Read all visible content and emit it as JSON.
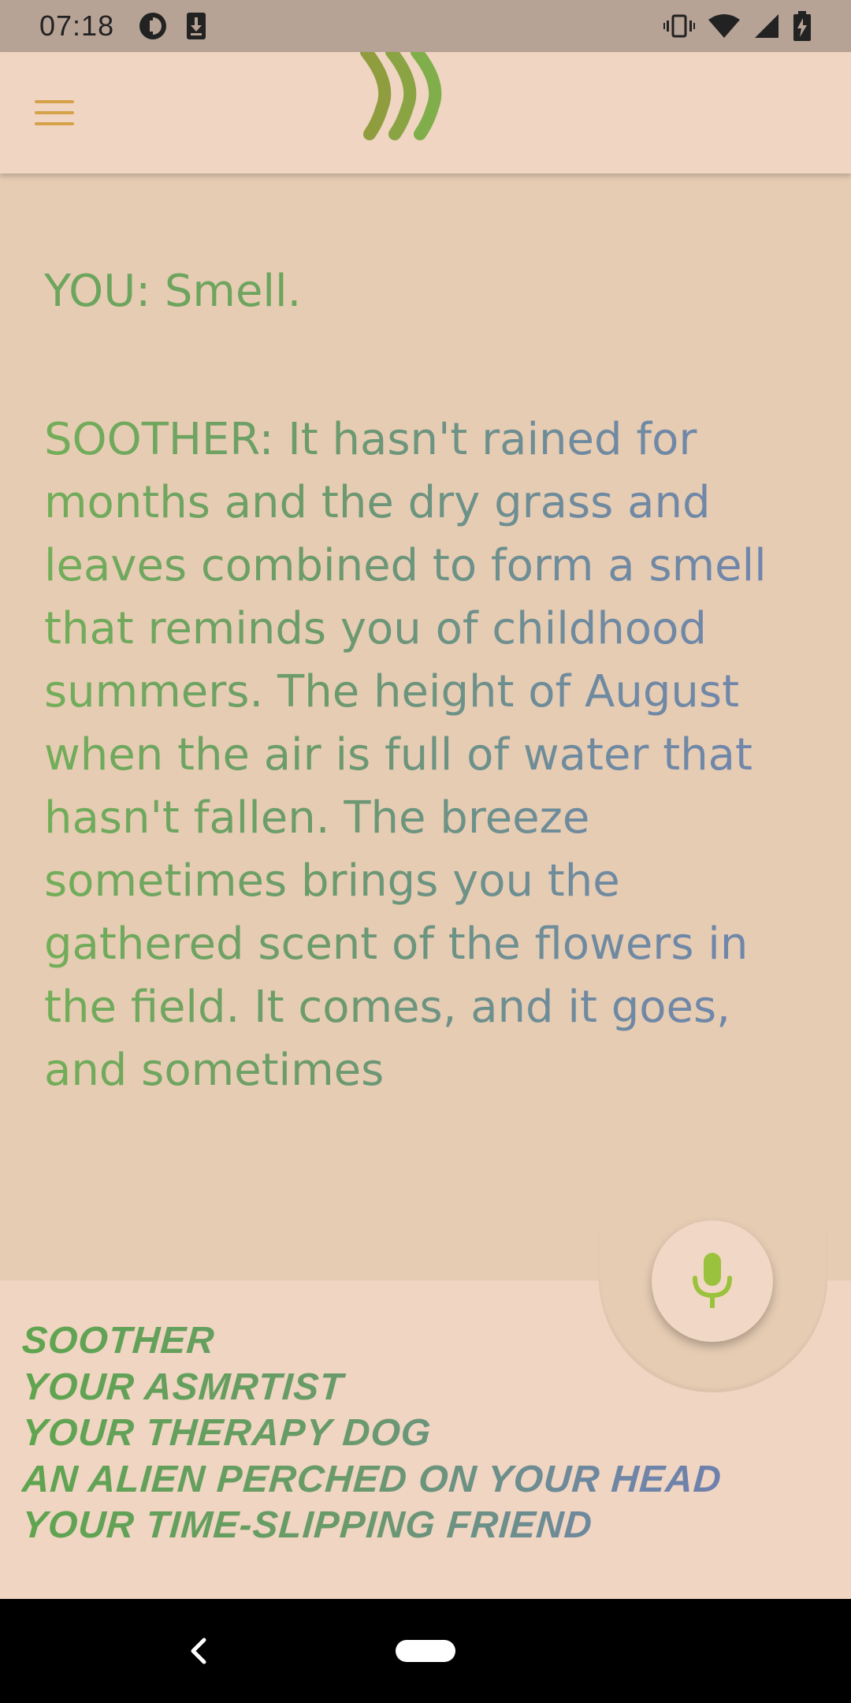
{
  "status_bar": {
    "time": "07:18",
    "left_icons": [
      "data-saver-icon",
      "download-icon"
    ],
    "right_icons": [
      "vibrate-icon",
      "wifi-icon",
      "signal-icon",
      "battery-charging-icon"
    ]
  },
  "app_bar": {
    "menu_icon": "hamburger-menu-icon",
    "logo_icon": "soother-waves-logo",
    "colors": {
      "menu": "#d5a24a",
      "logo_dark": "#8fa040",
      "logo_light": "#7fb04a"
    }
  },
  "conversation": {
    "you_line": "YOU: Smell.",
    "soother_line": "SOOTHER: It hasn't rained for months and the dry grass and leaves combined to form a smell that reminds you of childhood summers. The height of August when the air is full of water that hasn't fallen. The breeze sometimes brings you the gathered scent of the flowers in the field. It comes, and it goes, and sometimes"
  },
  "fab": {
    "icon": "microphone-icon",
    "color": "#9bc23c"
  },
  "personas": [
    "Soother",
    "Your ASMRtist",
    "Your Therapy Dog",
    "An Alien Perched on Your Head",
    "Your Time-Slipping Friend"
  ],
  "nav_bar": {
    "back_icon": "back-chevron-icon",
    "home_icon": "home-pill-icon"
  }
}
